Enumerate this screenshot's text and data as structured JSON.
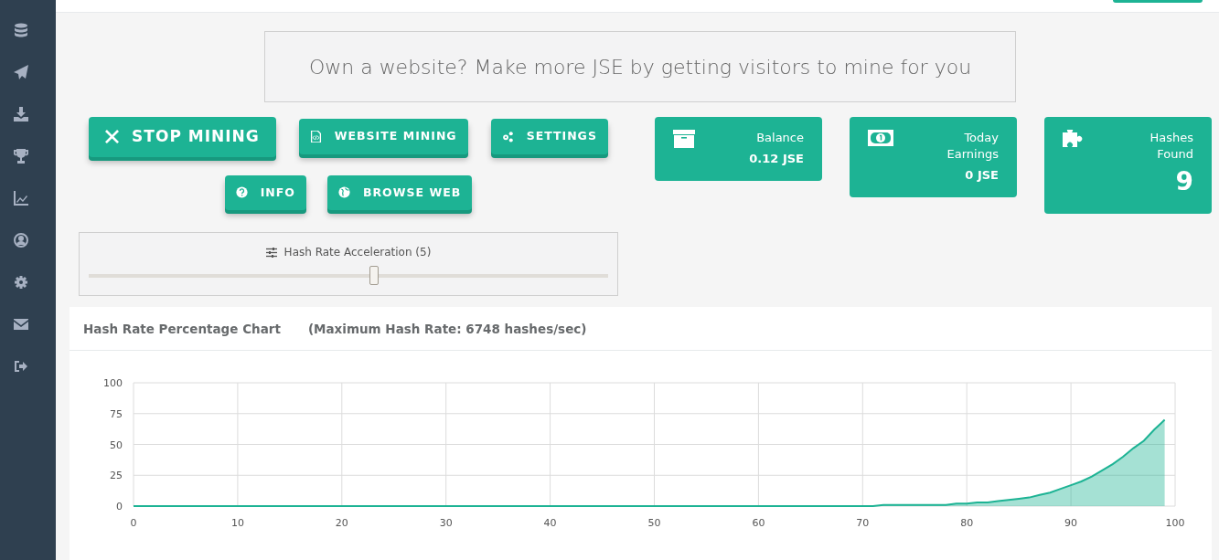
{
  "banner": {
    "text": "Own a website? Make more JSE by getting visitors to mine for you"
  },
  "button_rows": [
    [
      {
        "label": "STOP MINING",
        "kind": "large"
      },
      {
        "label": "WEBSITE MINING",
        "kind": "normal"
      },
      {
        "label": "SETTINGS",
        "kind": "normal"
      }
    ],
    [
      {
        "label": "INFO",
        "kind": "normal"
      },
      {
        "label": "BROWSE WEB",
        "kind": "normal"
      }
    ]
  ],
  "slider": {
    "label": "Hash Rate Acceleration (5)",
    "level": 0.55
  },
  "stats": [
    {
      "label": "Balance",
      "value": "0.12 JSE",
      "kind": "amount"
    },
    {
      "label": "Today Earnings",
      "value": "0 JSE",
      "kind": "amount"
    },
    {
      "label": "Hashes Found",
      "value": "9",
      "kind": "count"
    }
  ],
  "chart_panel": {
    "title": "Hash Rate Percentage Chart",
    "subtitle": "(Maximum Hash Rate: 6748 hashes/sec)",
    "chart_data": {
      "type": "area",
      "xlim": [
        0,
        100
      ],
      "ylim": [
        0,
        100
      ],
      "xticks": [
        0,
        10,
        20,
        30,
        40,
        50,
        60,
        70,
        80,
        90,
        100
      ],
      "yticks": [
        0,
        25,
        50,
        75,
        100
      ],
      "x": [
        0,
        1,
        2,
        3,
        4,
        5,
        6,
        7,
        8,
        9,
        10,
        11,
        12,
        13,
        14,
        15,
        16,
        17,
        18,
        19,
        20,
        21,
        22,
        23,
        24,
        25,
        26,
        27,
        28,
        29,
        30,
        31,
        32,
        33,
        34,
        35,
        36,
        37,
        38,
        39,
        40,
        41,
        42,
        43,
        44,
        45,
        46,
        47,
        48,
        49,
        50,
        51,
        52,
        53,
        54,
        55,
        56,
        57,
        58,
        59,
        60,
        61,
        62,
        63,
        64,
        65,
        66,
        67,
        68,
        69,
        70,
        71,
        72,
        73,
        74,
        75,
        76,
        77,
        78,
        79,
        80,
        81,
        82,
        83,
        84,
        85,
        86,
        87,
        88,
        89,
        90,
        91,
        92,
        93,
        94,
        95,
        96,
        97,
        98,
        99
      ],
      "grid": true,
      "series": [
        {
          "color": "#1db394",
          "values": [
            0,
            0,
            0,
            0,
            0,
            0,
            0,
            0,
            0,
            0,
            0,
            0,
            0,
            0,
            0,
            0,
            0,
            0,
            0,
            0,
            0,
            0,
            0,
            0,
            0,
            0,
            0,
            0,
            0,
            0,
            0,
            0,
            0,
            0,
            0,
            0,
            0,
            0,
            0,
            0,
            0,
            0,
            0,
            0,
            0,
            0,
            0,
            0,
            0,
            0,
            0,
            0,
            0,
            0,
            0,
            0,
            0,
            0,
            0,
            0,
            0,
            0,
            0,
            0,
            0,
            0,
            0,
            0,
            0,
            0,
            0,
            0,
            1,
            1,
            1,
            1,
            1,
            1,
            1,
            2,
            2,
            3,
            3,
            4,
            5,
            6,
            7,
            9,
            11,
            14,
            17,
            20,
            24,
            29,
            34,
            40,
            47,
            53,
            62,
            70
          ]
        }
      ]
    }
  }
}
